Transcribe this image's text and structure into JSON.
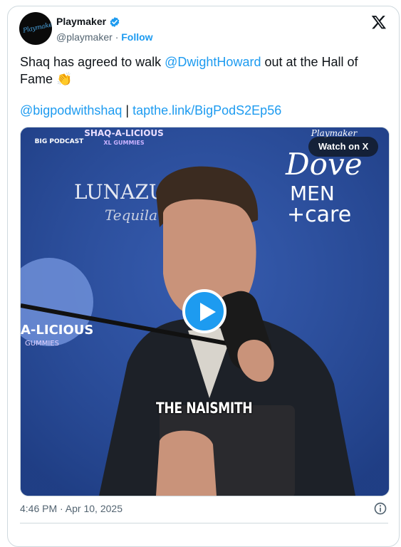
{
  "author": {
    "name": "Playmaker",
    "handle": "@playmaker",
    "separator": "·",
    "follow_label": "Follow",
    "avatar_text": "Playmaker"
  },
  "tweet": {
    "text_prefix": "Shaq has agreed to walk ",
    "mention": "@DwightHoward",
    "text_suffix": " out at the Hall of Fame 👏",
    "link1": "@bigpodwithshaq",
    "separator": " | ",
    "link2": "tapthe.link/BigPodS2Ep56"
  },
  "media": {
    "watch_label": "Watch on X",
    "caption": "THE NAISMITH",
    "banner_texts": {
      "big_podcast": "BIG PODCAST",
      "shaq": "SHAQ-A-LICIOUS",
      "shaq_sub": "XL GUMMIES",
      "lunazul": "LUNAZUL",
      "tequila": "Tequila",
      "dove": "Dove",
      "men": "MEN",
      "care": "+care",
      "playmaker": "Playmaker",
      "side_logo": "A-LICIOUS",
      "side_sub": "GUMMIES"
    }
  },
  "footer": {
    "timestamp": "4:46 PM · Apr 10, 2025"
  },
  "colors": {
    "accent": "#1d9bf0",
    "text": "#0f1419",
    "secondary": "#536471",
    "backdrop": "#2f4f9e"
  }
}
